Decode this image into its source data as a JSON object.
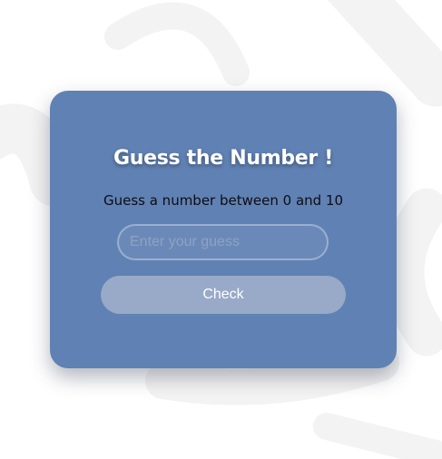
{
  "game": {
    "title": "Guess the Number !",
    "instructions": "Guess a number between 0 and 10",
    "input": {
      "placeholder": "Enter your guess",
      "value": ""
    },
    "check_label": "Check"
  },
  "colors": {
    "card_background": "#6081b3",
    "button_background": "#98aac7",
    "page_background": "#ffffff",
    "decor": "#f3f3f3"
  }
}
